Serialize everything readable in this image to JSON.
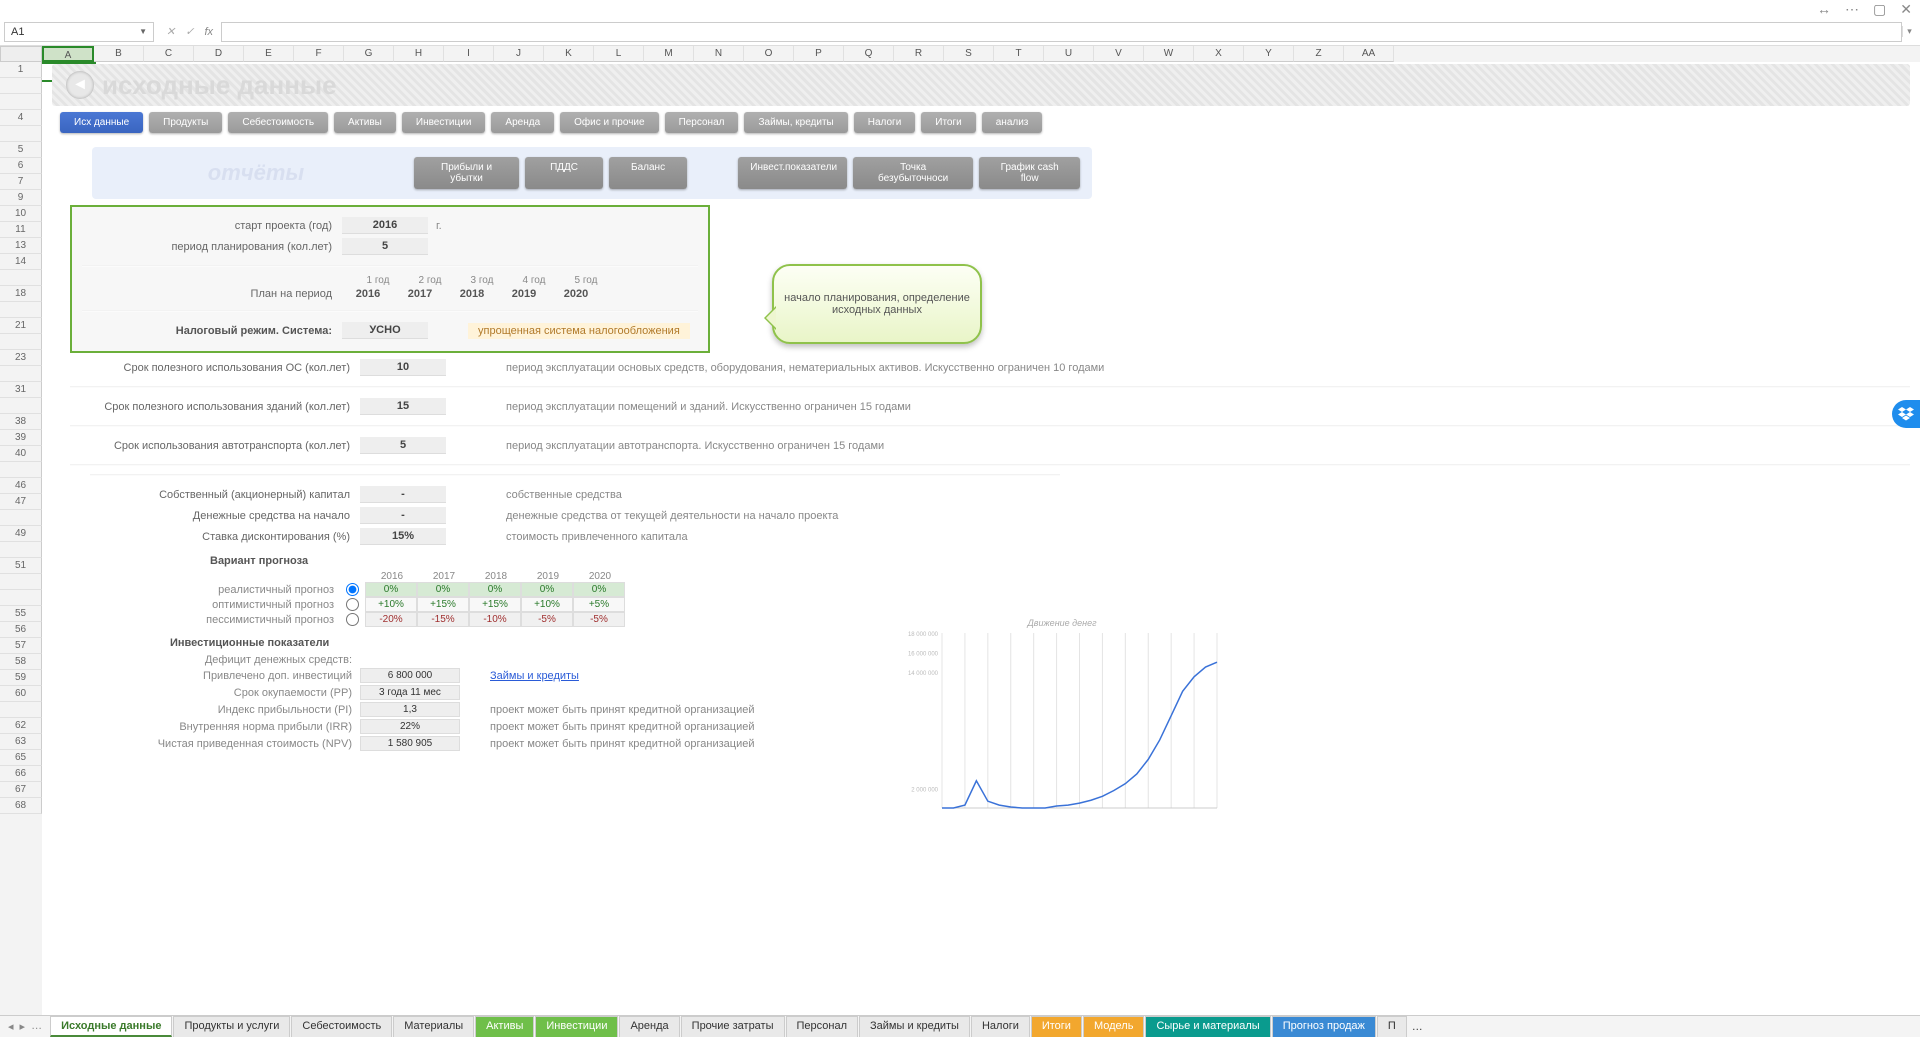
{
  "window": {
    "cell_ref": "A1"
  },
  "banner": {
    "title": "исходные данные"
  },
  "nav": {
    "items": [
      "Исх данные",
      "Продукты",
      "Себестоимость",
      "Активы",
      "Инвестиции",
      "Аренда",
      "Офис и прочие",
      "Персонал",
      "Займы, кредиты",
      "Налоги",
      "Итоги",
      "анализ"
    ],
    "active_index": 0
  },
  "reports": {
    "label": "отчёты",
    "buttons_left": [
      "Прибыли и убытки",
      "ПДДС",
      "Баланс"
    ],
    "buttons_right": [
      "Инвест.показатели",
      "Точка безубыточноси",
      "График cash flow"
    ]
  },
  "callout": "начало планирования, определение исходных данных",
  "greenbox": {
    "start_label": "старт проекта (год)",
    "start_value": "2016",
    "start_unit": "г.",
    "period_label": "период планирования (кол.лет)",
    "period_value": "5",
    "year_heads": [
      "1 год",
      "2 год",
      "3 год",
      "4 год",
      "5 год"
    ],
    "plan_label": "План на период",
    "plan_years": [
      "2016",
      "2017",
      "2018",
      "2019",
      "2020"
    ],
    "tax_label": "Налоговый режим. Система:",
    "tax_value": "УСНО",
    "tax_desc": "упрощенная система налогообложения"
  },
  "useful_life": [
    {
      "label": "Срок полезного использования  ОС  (кол.лет)",
      "value": "10",
      "desc": "период эксплуатации основых средств, оборудования, нематериальных активов. Искусственно ограничен 10 годами"
    },
    {
      "label": "Срок полезного использования зданий (кол.лет)",
      "value": "15",
      "desc": "период эксплуатации помещений и зданий. Искусственно ограничен 15 годами"
    },
    {
      "label": "Срок использования  автотранспорта (кол.лет)",
      "value": "5",
      "desc": "период эксплуатации автотранспорта. Искусственно ограничен 15 годами"
    }
  ],
  "capital": [
    {
      "label": "Собственный (акционерный) капитал",
      "value": "-",
      "desc": "собственные средства"
    },
    {
      "label": "Денежные средства на начало",
      "value": "-",
      "desc": "денежные средства от текущей деятельности на начало проекта"
    },
    {
      "label": "Ставка дисконтирования (%)",
      "value": "15%",
      "desc": "стоимость привлеченного капитала"
    }
  ],
  "forecast": {
    "title": "Вариант прогноза",
    "years": [
      "2016",
      "2017",
      "2018",
      "2019",
      "2020"
    ],
    "rows": [
      {
        "label": "реалистичный прогноз",
        "checked": true,
        "cells": [
          "0%",
          "0%",
          "0%",
          "0%",
          "0%"
        ],
        "kind": "realistic"
      },
      {
        "label": "оптимистичный прогноз",
        "checked": false,
        "cells": [
          "+10%",
          "+15%",
          "+15%",
          "+10%",
          "+5%"
        ],
        "kind": "opt"
      },
      {
        "label": "пессимистичный прогноз",
        "checked": false,
        "cells": [
          "-20%",
          "-15%",
          "-10%",
          "-5%",
          "-5%"
        ],
        "kind": "pes"
      }
    ]
  },
  "invest": {
    "title": "Инвестиционные показатели",
    "deficit_label": "Дефицит денежных средств:",
    "rows": [
      {
        "label": "Привлечено доп. инвестиций",
        "value": "6 800 000",
        "link": "Займы и кредиты"
      },
      {
        "label": "Срок окупаемости  (PP)",
        "value": "3 года 11 мес"
      },
      {
        "label": "Индекс прибыльности  (PI)",
        "value": "1,3",
        "desc": "проект может быть принят кредитной организацией"
      },
      {
        "label": "Внутренняя норма прибыли (IRR)",
        "value": "22%",
        "desc": "проект может быть принят кредитной организацией"
      },
      {
        "label": "Чистая приведенная стоимость (NPV)",
        "value": "1 580 905",
        "desc": "проект может быть принят кредитной организацией"
      }
    ]
  },
  "chart_data": {
    "type": "line",
    "title": "Движение денег",
    "x": [
      0,
      1,
      2,
      3,
      4,
      5,
      6,
      7,
      8,
      9,
      10,
      11,
      12,
      13,
      14,
      15,
      16,
      17,
      18,
      19,
      20,
      21,
      22,
      23,
      24
    ],
    "series": [
      {
        "name": "cashflow",
        "values": [
          0,
          0,
          0.3,
          2.8,
          0.7,
          0.3,
          0.1,
          0,
          0,
          0,
          0.2,
          0.3,
          0.5,
          0.8,
          1.2,
          1.8,
          2.5,
          3.5,
          5,
          7,
          9.5,
          12,
          13.5,
          14.5,
          15
        ],
        "color": "#3a72d8"
      }
    ],
    "ylim": [
      0,
      18
    ],
    "y_ticks_millions": [
      18,
      16,
      14,
      2
    ],
    "grid": true
  },
  "sheet_tabs": {
    "tabs": [
      {
        "label": "Исходные данные",
        "style": "active"
      },
      {
        "label": "Продукты и услуги",
        "style": ""
      },
      {
        "label": "Себестоимость",
        "style": ""
      },
      {
        "label": "Материалы",
        "style": ""
      },
      {
        "label": "Активы",
        "style": "green"
      },
      {
        "label": "Инвестиции",
        "style": "green"
      },
      {
        "label": "Аренда",
        "style": ""
      },
      {
        "label": "Прочие затраты",
        "style": ""
      },
      {
        "label": "Персонал",
        "style": ""
      },
      {
        "label": "Займы и кредиты",
        "style": ""
      },
      {
        "label": "Налоги",
        "style": ""
      },
      {
        "label": "Итоги",
        "style": "orange"
      },
      {
        "label": "Модель",
        "style": "orange"
      },
      {
        "label": "Сырье и материалы",
        "style": "teal"
      },
      {
        "label": "Прогноз продаж",
        "style": "blue"
      },
      {
        "label": "П",
        "style": ""
      }
    ]
  },
  "columns": [
    "A",
    "B",
    "C",
    "D",
    "E",
    "F",
    "G",
    "H",
    "I",
    "J",
    "K",
    "L",
    "M",
    "N",
    "O",
    "P",
    "Q",
    "R",
    "S",
    "T",
    "U",
    "V",
    "W",
    "X",
    "Y",
    "Z",
    "AA"
  ],
  "visible_rows": [
    "1",
    "",
    "",
    "4",
    "",
    "5",
    "6",
    "7",
    "9",
    "10",
    "11",
    "13",
    "14",
    "",
    "18",
    "",
    "21",
    "",
    "23",
    "",
    "31",
    "",
    "38",
    "39",
    "40",
    "",
    "46",
    "47",
    "",
    "49",
    "",
    "51",
    "",
    "",
    "55",
    "56",
    "57",
    "58",
    "59",
    "60",
    "",
    "62",
    "63",
    "65",
    "66",
    "67",
    "68"
  ]
}
